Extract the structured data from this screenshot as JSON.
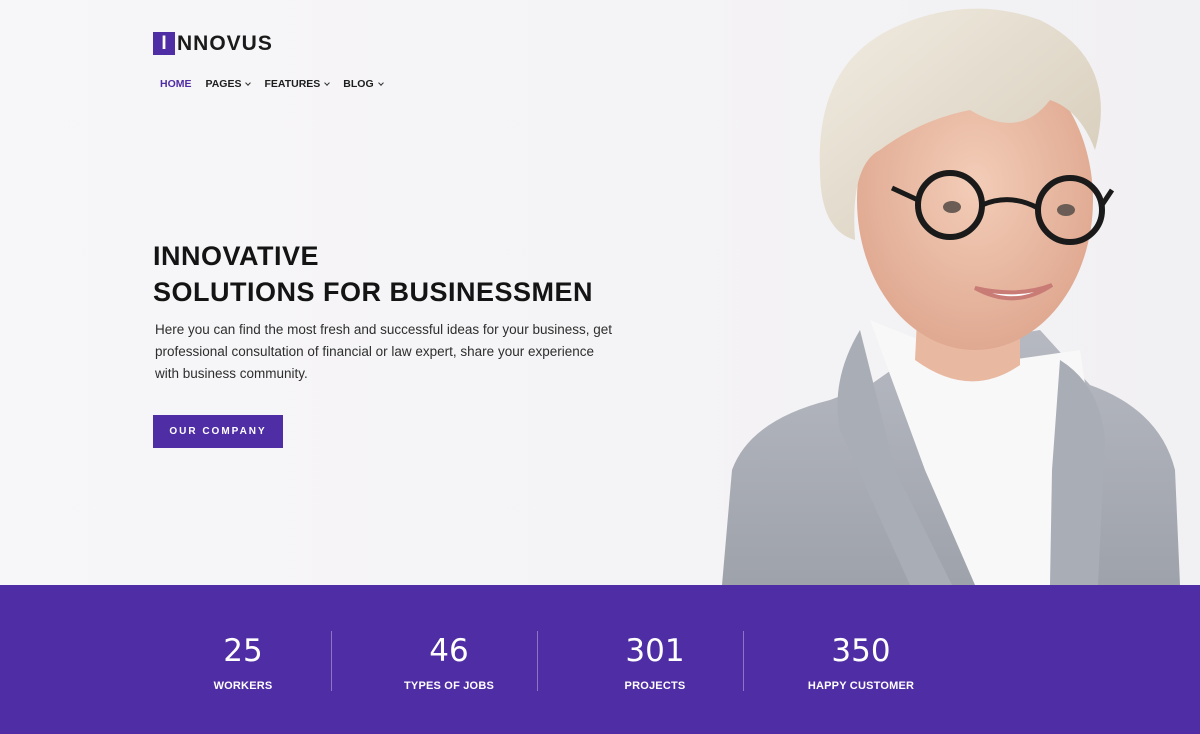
{
  "brand": {
    "logo_mark": "I",
    "logo_rest": "NNOVUS",
    "accent": "#4f2da4"
  },
  "nav": {
    "items": [
      {
        "label": "HOME",
        "active": true,
        "dropdown": false
      },
      {
        "label": "PAGES",
        "active": false,
        "dropdown": true
      },
      {
        "label": "FEATURES",
        "active": false,
        "dropdown": true
      },
      {
        "label": "BLOG",
        "active": false,
        "dropdown": true
      }
    ]
  },
  "hero": {
    "title_line1": "INNOVATIVE",
    "title_line2": "SOLUTIONS FOR BUSINESSMEN",
    "description": "Here you can find the most fresh and successful ideas for your business, get professional consultation of financial or law expert, share your experience with business community.",
    "cta_label": "OUR COMPANY"
  },
  "stats": [
    {
      "value": "25",
      "label": "WORKERS"
    },
    {
      "value": "46",
      "label": "TYPES OF JOBS"
    },
    {
      "value": "301",
      "label": "PROJECTS"
    },
    {
      "value": "350",
      "label": "HAPPY CUSTOMER"
    }
  ]
}
